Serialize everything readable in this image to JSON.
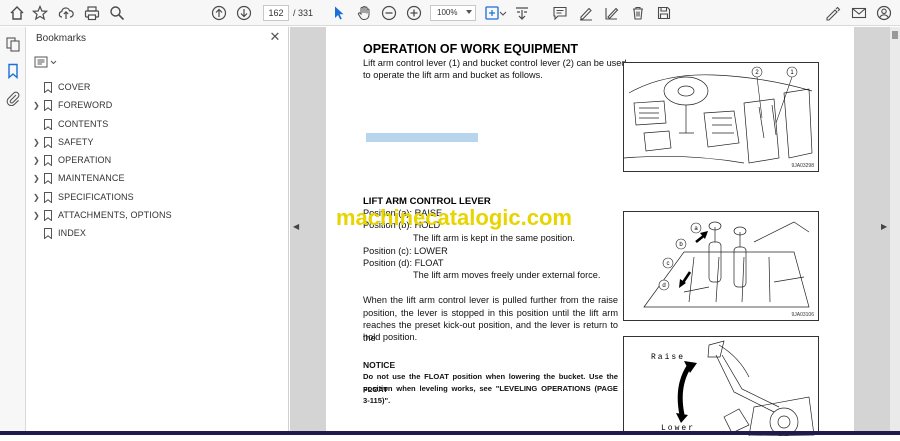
{
  "toolbar": {
    "page_current": "162",
    "page_total": "/ 331",
    "zoom": "100%"
  },
  "bookmarks_panel": {
    "title": "Bookmarks",
    "items": [
      {
        "label": "COVER",
        "expandable": false
      },
      {
        "label": "FOREWORD",
        "expandable": true
      },
      {
        "label": "CONTENTS",
        "expandable": false
      },
      {
        "label": "SAFETY",
        "expandable": true
      },
      {
        "label": "OPERATION",
        "expandable": true
      },
      {
        "label": "MAINTENANCE",
        "expandable": true
      },
      {
        "label": "SPECIFICATIONS",
        "expandable": true
      },
      {
        "label": "ATTACHMENTS, OPTIONS",
        "expandable": true
      },
      {
        "label": "INDEX",
        "expandable": false
      }
    ]
  },
  "document": {
    "heading": "OPERATION OF WORK EQUIPMENT",
    "intro_line1": "Lift arm control lever (1) and bucket control lever (2) can be used",
    "intro_line2": "to operate the lift arm and bucket as follows.",
    "subheading": "LIFT ARM CONTROL LEVER",
    "pos_a": "Position (a): RAISE",
    "pos_b": "Position (b): HOLD",
    "pos_b_desc": "The lift arm is kept in the same position.",
    "pos_c": "Position (c): LOWER",
    "pos_d": "Position (d): FLOAT",
    "pos_d_desc": "The lift arm moves freely under external force.",
    "para_line1": "When the lift arm control lever is pulled further from the raise",
    "para_line2": "position, the lever is stopped in this position until the lift arm",
    "para_line3": "reaches the preset kick-out position, and the lever is return to the",
    "para_line4": "hold position.",
    "notice_title": "NOTICE",
    "notice_line1": "Do not use the FLOAT position when lowering the bucket.  Use the FLOAT",
    "notice_line2": "position when leveling works, see \"LEVELING OPERATIONS (PAGE",
    "notice_line3": "3-115)\".",
    "watermark": "machinecatalogic.com",
    "fig1_code": "9JA03298",
    "fig2_code": "9JA03106",
    "fig1_label1": "1",
    "fig1_label2": "2",
    "fig2_a": "a",
    "fig2_b": "b",
    "fig2_c": "c",
    "fig2_d": "d",
    "fig3_raise": "Raise",
    "fig3_lower": "Lower"
  }
}
